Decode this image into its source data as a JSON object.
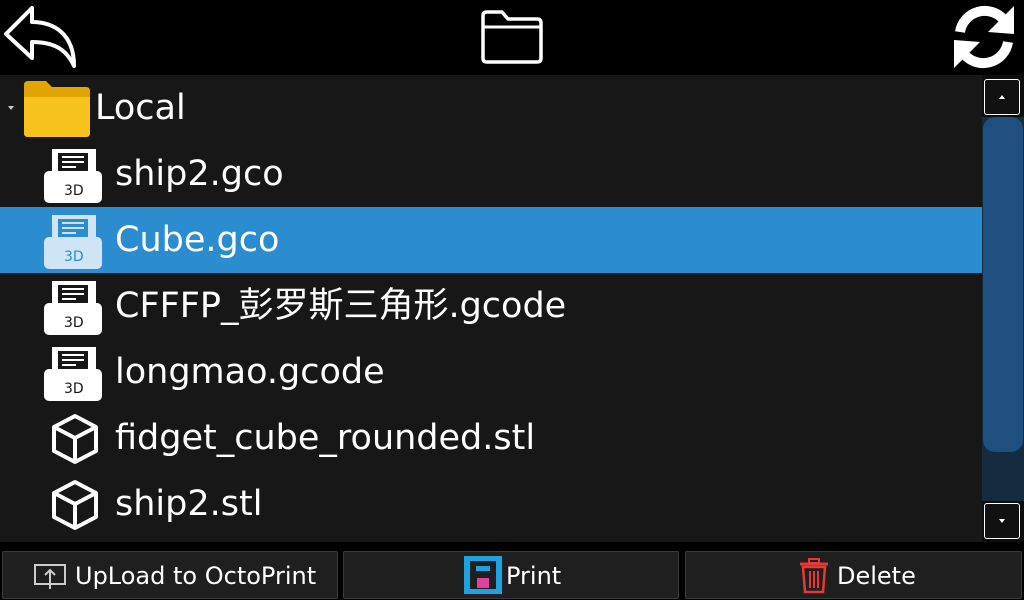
{
  "topbar": {
    "back_icon": "back-arrow-icon",
    "folder_icon": "folder-outline-icon",
    "refresh_icon": "refresh-icon"
  },
  "tree": {
    "root": {
      "label": "Local",
      "icon": "folder-icon",
      "expanded": true
    },
    "items": [
      {
        "label": "ship2.gco",
        "icon": "gcode-3d-icon",
        "selected": false
      },
      {
        "label": "Cube.gco",
        "icon": "gcode-3d-icon",
        "selected": true
      },
      {
        "label": "CFFFP_彭罗斯三角形.gcode",
        "icon": "gcode-3d-icon",
        "selected": false
      },
      {
        "label": "longmao.gcode",
        "icon": "gcode-3d-icon",
        "selected": false
      },
      {
        "label": "fidget_cube_rounded.stl",
        "icon": "cube-icon",
        "selected": false
      },
      {
        "label": "ship2.stl",
        "icon": "cube-icon",
        "selected": false
      }
    ]
  },
  "actions": {
    "upload_label": "UpLoad to OctoPrint",
    "print_label": "Print",
    "delete_label": "Delete"
  },
  "colors": {
    "selection": "#2b8ccf",
    "list_bg": "#171717",
    "folder": "#f5b800",
    "delete_icon": "#e53935",
    "print_frame": "#1fa3e0",
    "print_part": "#e040a0"
  }
}
